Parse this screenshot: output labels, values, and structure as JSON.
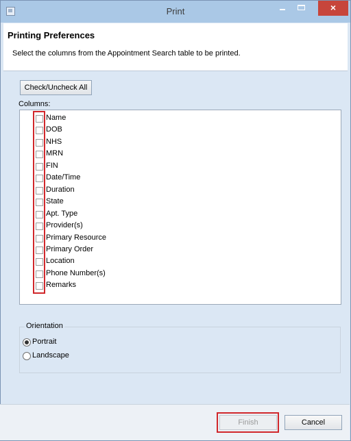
{
  "window": {
    "title": "Print",
    "close_glyph": "×",
    "icons": [
      "app-icon",
      "minimize-icon",
      "maximize-icon",
      "close-icon"
    ]
  },
  "header": {
    "heading": "Printing Preferences",
    "description": "Select the columns from the Appointment Search table to be printed."
  },
  "check_all_label": "Check/Uncheck All",
  "columns": {
    "label": "Columns:",
    "items": [
      {
        "label": "Name",
        "checked": false
      },
      {
        "label": "DOB",
        "checked": false
      },
      {
        "label": "NHS",
        "checked": false
      },
      {
        "label": "MRN",
        "checked": false
      },
      {
        "label": "FIN",
        "checked": false
      },
      {
        "label": "Date/Time",
        "checked": false
      },
      {
        "label": "Duration",
        "checked": false
      },
      {
        "label": "State",
        "checked": false
      },
      {
        "label": "Apt. Type",
        "checked": false
      },
      {
        "label": "Provider(s)",
        "checked": false
      },
      {
        "label": "Primary Resource",
        "checked": false
      },
      {
        "label": "Primary Order",
        "checked": false
      },
      {
        "label": "Location",
        "checked": false
      },
      {
        "label": "Phone Number(s)",
        "checked": false
      },
      {
        "label": "Remarks",
        "checked": false
      }
    ]
  },
  "orientation": {
    "label": "Orientation",
    "options": [
      {
        "label": "Portrait",
        "selected": true
      },
      {
        "label": "Landscape",
        "selected": false
      }
    ]
  },
  "buttons": {
    "finish": "Finish",
    "finish_enabled": false,
    "cancel": "Cancel"
  },
  "colors": {
    "highlight": "#d0262a",
    "close_button": "#c7453b",
    "dialog_background": "#dbe7f4"
  }
}
